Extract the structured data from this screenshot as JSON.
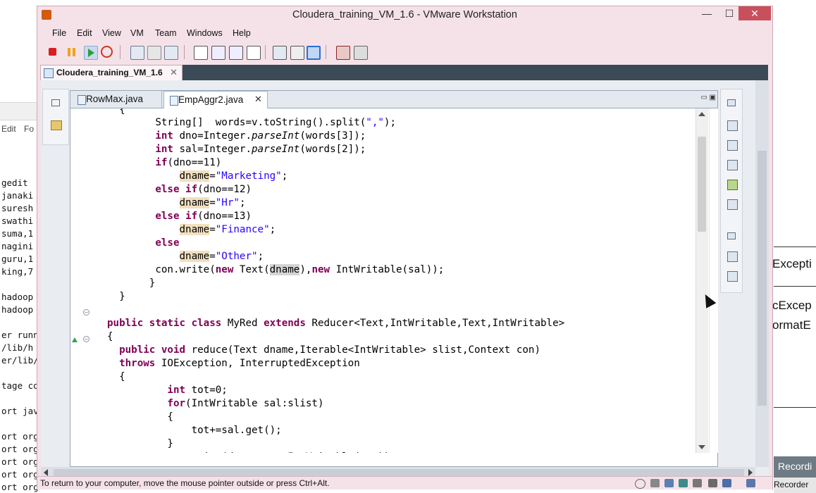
{
  "background_left": {
    "menu": [
      "Edit",
      "Fo"
    ],
    "lines": [
      "gedit",
      "janaki",
      "suresh",
      "swathi",
      "suma,1",
      "nagini",
      "guru,1",
      "king,7",
      "",
      "hadoop",
      "hadoop",
      "",
      "er runn",
      "/lib/h",
      "er/lib/",
      "",
      "tage co",
      "",
      "ort jav",
      "",
      "ort org",
      "ort org",
      "ort org",
      "ort org",
      "ort org"
    ]
  },
  "background_right": {
    "texts": [
      "Excepti",
      "cExcep",
      "ormatE"
    ],
    "taskbar_label": "Recordi",
    "taskbar_label2": "Recorder"
  },
  "window": {
    "title": "Cloudera_training_VM_1.6 - VMware Workstation",
    "controls": {
      "minimize": "—",
      "maximize": "☐",
      "close": "✕"
    },
    "menu": [
      "File",
      "Edit",
      "View",
      "VM",
      "Team",
      "Windows",
      "Help"
    ],
    "vm_tab": {
      "label": "Cloudera_training_VM_1.6",
      "close": "✕"
    },
    "status_message": "To return to your computer, move the mouse pointer outside or press Ctrl+Alt.",
    "toolbar_colors": {
      "power_off": "#d81e1e",
      "suspend": "#f0a21c",
      "power_on": "#2e9e3a",
      "reset": "#c93a1d",
      "active_view": "#2a6fd1"
    }
  },
  "eclipse": {
    "tabs": [
      {
        "label": "RowMax.java",
        "active": false
      },
      {
        "label": "EmpAggr2.java",
        "active": true,
        "close": "✕"
      }
    ],
    "editor_controls": "▭ ▣"
  }
}
